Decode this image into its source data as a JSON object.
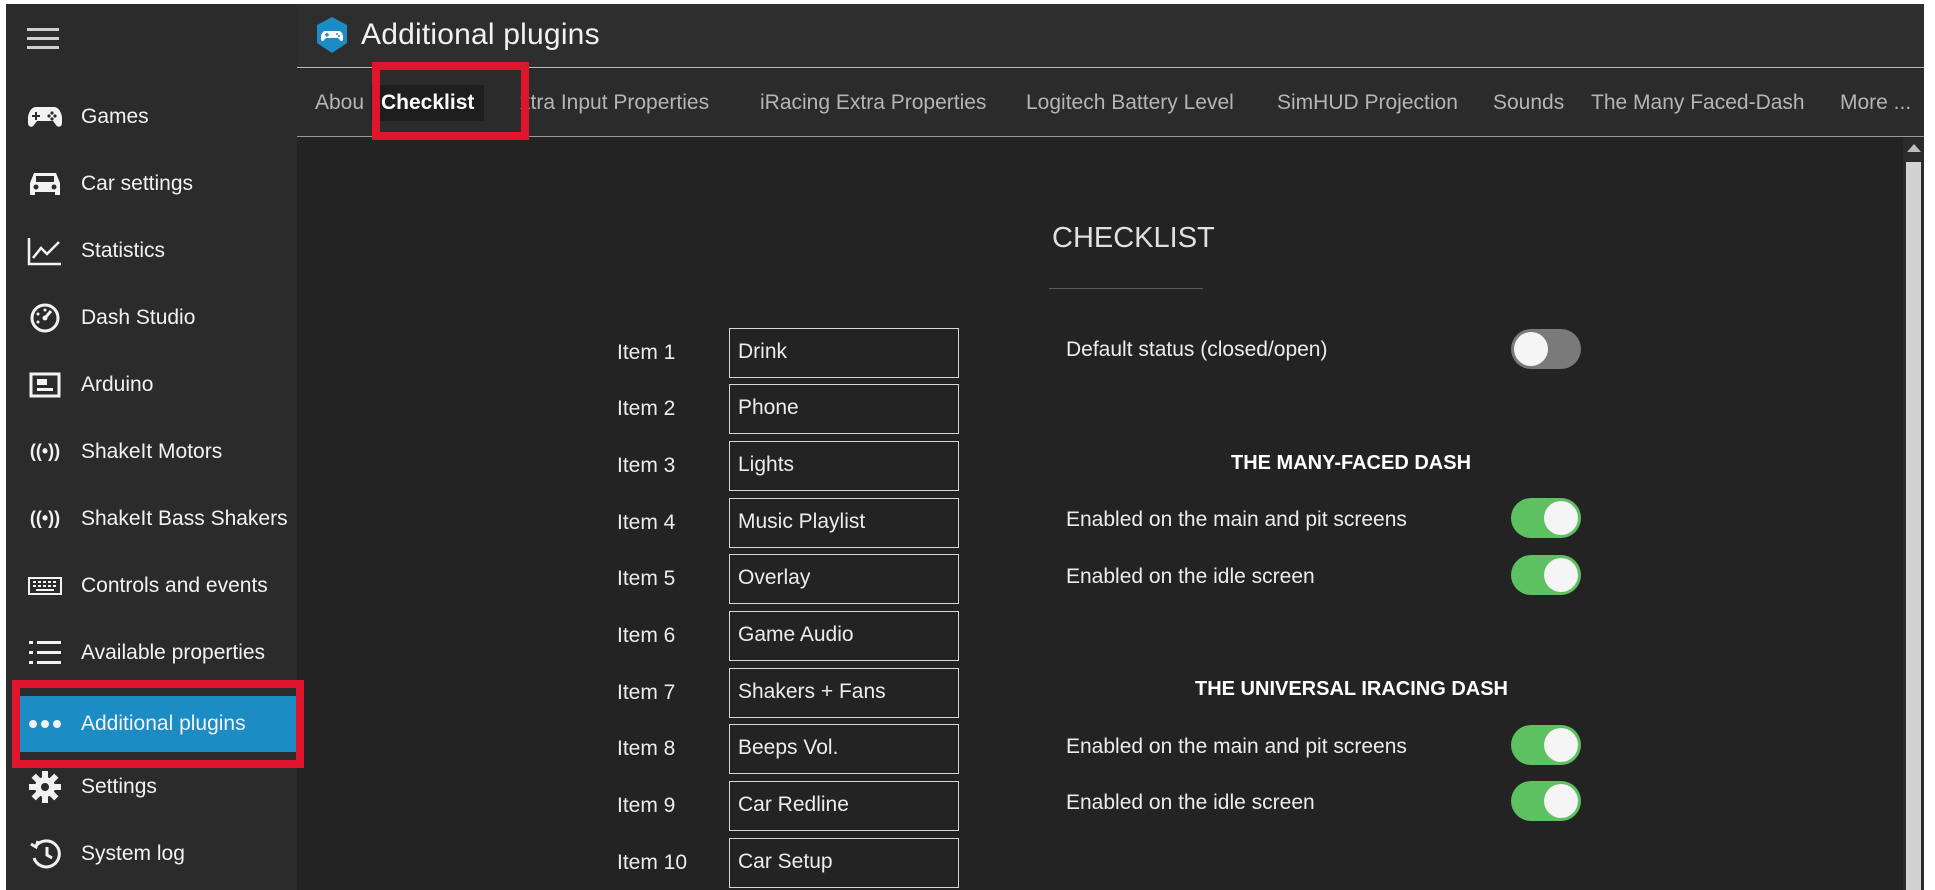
{
  "header": {
    "title": "Additional plugins",
    "logo_icon": "gamepad-logo-icon"
  },
  "sidebar": {
    "menu_icon": "hamburger-icon",
    "items": [
      {
        "label": "Games",
        "icon": "gamepad-icon"
      },
      {
        "label": "Car settings",
        "icon": "car-icon"
      },
      {
        "label": "Statistics",
        "icon": "chart-icon"
      },
      {
        "label": "Dash Studio",
        "icon": "gauge-icon"
      },
      {
        "label": "Arduino",
        "icon": "arduino-icon"
      },
      {
        "label": "ShakeIt Motors",
        "icon": "vibration-icon"
      },
      {
        "label": "ShakeIt Bass Shakers",
        "icon": "vibration-icon"
      },
      {
        "label": "Controls and events",
        "icon": "keyboard-icon"
      },
      {
        "label": "Available properties",
        "icon": "list-icon"
      },
      {
        "label": "Additional plugins",
        "icon": "dots-icon",
        "active": true
      },
      {
        "label": "Settings",
        "icon": "gear-icon"
      },
      {
        "label": "System log",
        "icon": "history-icon"
      }
    ],
    "accent_color": "#1c8cc4"
  },
  "tabs": [
    "Abou",
    "Checklist",
    "xtra Input Properties",
    "iRacing Extra Properties",
    "Logitech Battery Level",
    "SimHUD Projection",
    "Sounds",
    "The Many Faced-Dash",
    "More ..."
  ],
  "content": {
    "section_title": "CHECKLIST",
    "items": [
      {
        "label": "Item 1",
        "value": "Drink"
      },
      {
        "label": "Item 2",
        "value": "Phone"
      },
      {
        "label": "Item 3",
        "value": "Lights"
      },
      {
        "label": "Item 4",
        "value": "Music Playlist"
      },
      {
        "label": "Item 5",
        "value": "Overlay"
      },
      {
        "label": "Item 6",
        "value": "Game Audio"
      },
      {
        "label": "Item 7",
        "value": "Shakers + Fans"
      },
      {
        "label": "Item 8",
        "value": "Beeps Vol."
      },
      {
        "label": "Item 9",
        "value": "Car Redline"
      },
      {
        "label": "Item 10",
        "value": "Car Setup"
      }
    ],
    "default_status": {
      "label": "Default status (closed/open)",
      "on": false
    },
    "many_faced_dash": {
      "heading": "THE MANY-FACED DASH",
      "main_pit": {
        "label": "Enabled on the main and pit screens",
        "on": true
      },
      "idle": {
        "label": "Enabled on the idle screen",
        "on": true
      }
    },
    "universal_iracing_dash": {
      "heading": "THE UNIVERSAL IRACING DASH",
      "main_pit": {
        "label": "Enabled on the main and pit screens",
        "on": true
      },
      "idle": {
        "label": "Enabled on the idle screen",
        "on": true
      }
    }
  },
  "colors": {
    "toggle_on": "#5dc162",
    "toggle_off": "#7a7a7a",
    "highlight": "#e0142a"
  }
}
